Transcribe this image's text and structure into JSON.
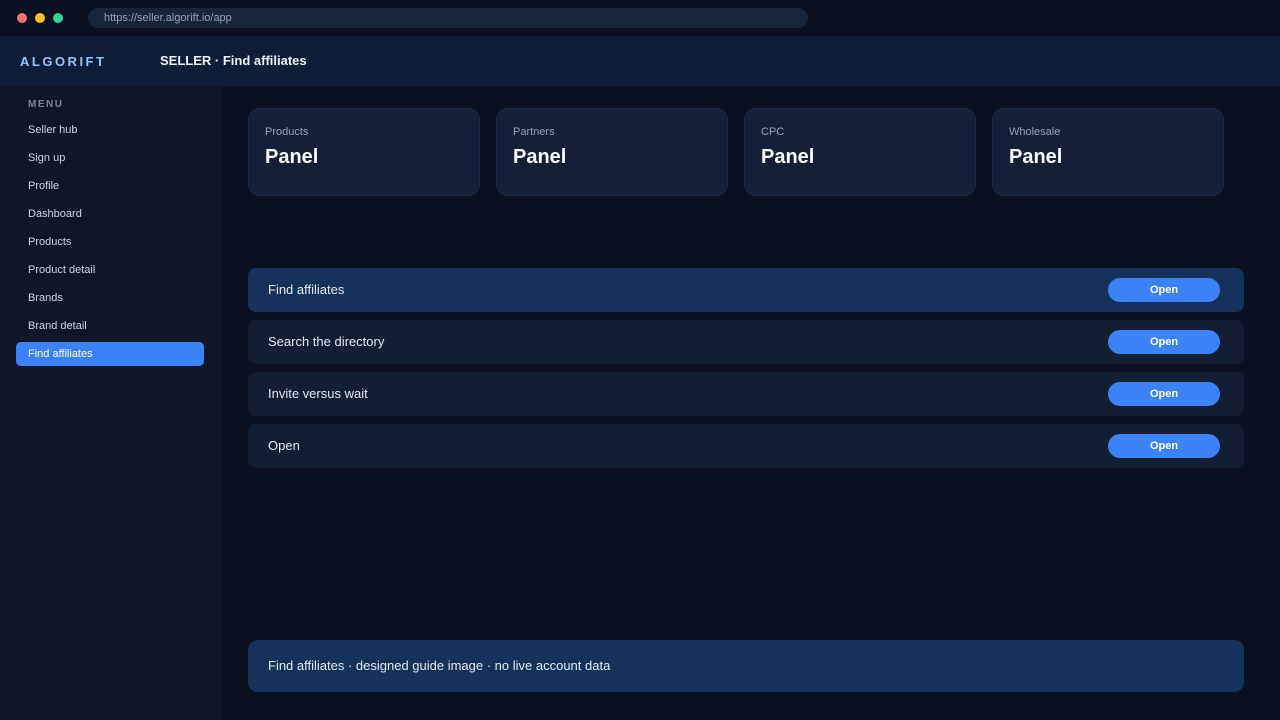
{
  "browser": {
    "url": "https://seller.algorift.io/app"
  },
  "header": {
    "logo": "ALGORIFT",
    "title": "SELLER · Find affiliates"
  },
  "sidebar": {
    "heading": "MENU",
    "items": [
      {
        "label": "Seller hub"
      },
      {
        "label": "Sign up"
      },
      {
        "label": "Profile"
      },
      {
        "label": "Dashboard"
      },
      {
        "label": "Products"
      },
      {
        "label": "Product detail"
      },
      {
        "label": "Brands"
      },
      {
        "label": "Brand detail"
      },
      {
        "label": "Find affiliates",
        "active": true
      }
    ]
  },
  "cards": [
    {
      "label": "Products",
      "value": "Panel"
    },
    {
      "label": "Partners",
      "value": "Panel"
    },
    {
      "label": "CPC",
      "value": "Panel"
    },
    {
      "label": "Wholesale",
      "value": "Panel"
    }
  ],
  "rows": [
    {
      "label": "Find affiliates",
      "button": "Open",
      "active": true
    },
    {
      "label": "Search the directory",
      "button": "Open"
    },
    {
      "label": "Invite versus wait",
      "button": "Open"
    },
    {
      "label": "Open",
      "button": "Open"
    }
  ],
  "footer": {
    "text": "Find affiliates · designed guide image · no live account data"
  },
  "colors": {
    "accent": "#3b82f6",
    "active_row": "#17325a",
    "background": "#0b1120"
  }
}
